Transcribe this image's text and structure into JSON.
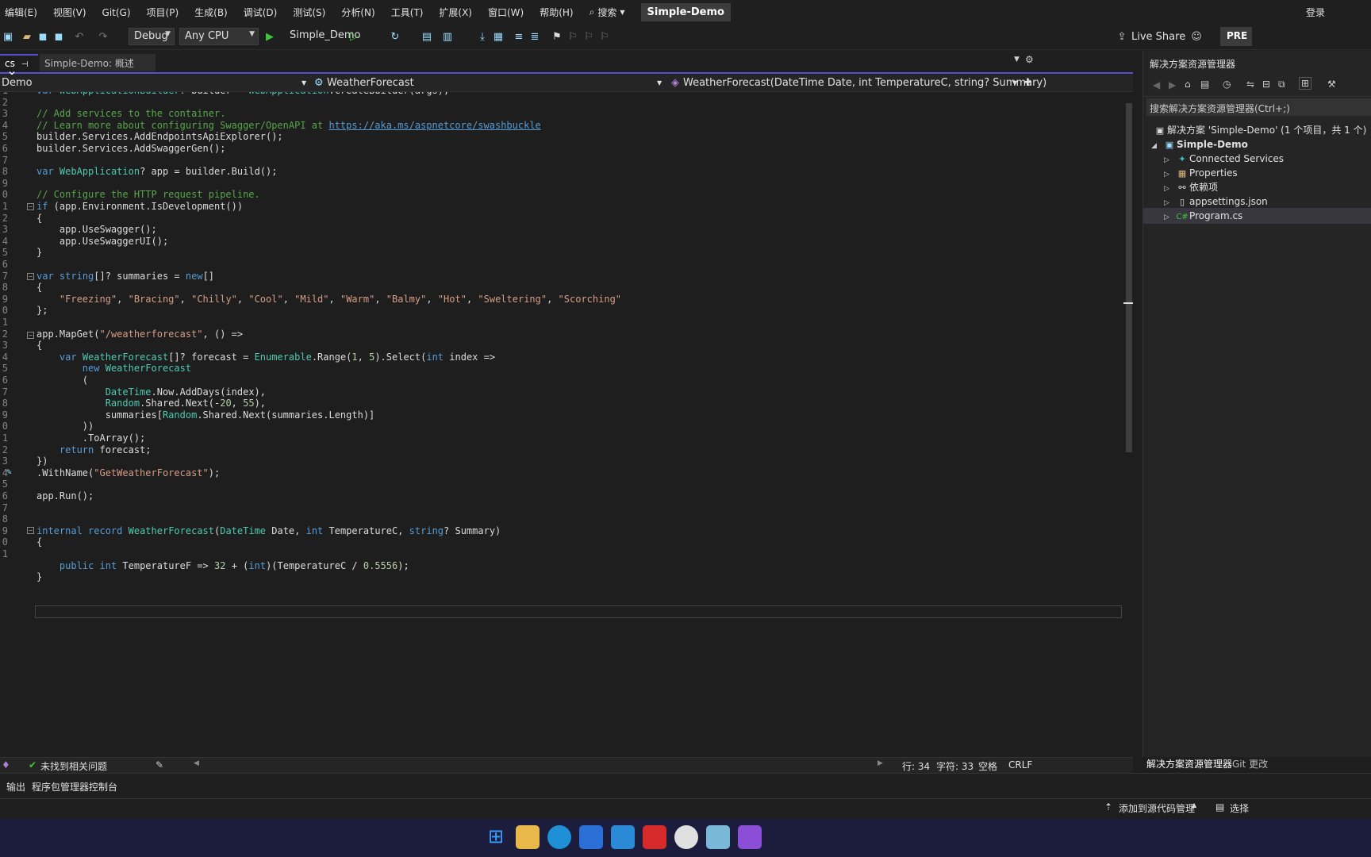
{
  "menu": [
    "编辑(E)",
    "视图(V)",
    "Git(G)",
    "项目(P)",
    "生成(B)",
    "调试(D)",
    "测试(S)",
    "分析(N)",
    "工具(T)",
    "扩展(X)",
    "窗口(W)",
    "帮助(H)"
  ],
  "search_label": "搜索",
  "title_badge": "Simple-Demo",
  "login": "登录",
  "toolbar": {
    "config": "Debug",
    "platform": "Any CPU",
    "run_target": "Simple_Demo",
    "live_share": "Live Share",
    "preview": "PRE"
  },
  "tabs": {
    "active": "cs",
    "other": "Simple-Demo: 概述"
  },
  "nav": {
    "project": "Demo",
    "type": "WeatherForecast",
    "member": "WeatherForecast(DateTime Date, int TemperatureC, string? Summary)"
  },
  "code": {
    "line_numbers": [
      "1",
      "2",
      "3",
      "4",
      "5",
      "6",
      "7",
      "8",
      "9",
      "0",
      "1",
      "2",
      "3",
      "4",
      "5",
      "6",
      "7",
      "8",
      "9",
      "0",
      "1",
      "2",
      "3",
      "4",
      "5",
      "6",
      "7",
      "8",
      "9",
      "0",
      "1",
      "2",
      "3",
      "4",
      "5",
      "6",
      "7",
      "8",
      "9",
      "0",
      "1"
    ],
    "lines": [
      "var WebApplicationBuilder? builder = WebApplication.CreateBuilder(args);",
      "",
      "// Add services to the container.",
      "// Learn more about configuring Swagger/OpenAPI at https://aka.ms/aspnetcore/swashbuckle",
      "builder.Services.AddEndpointsApiExplorer();",
      "builder.Services.AddSwaggerGen();",
      "",
      "var WebApplication? app = builder.Build();",
      "",
      "// Configure the HTTP request pipeline.",
      "if (app.Environment.IsDevelopment())",
      "{",
      "    app.UseSwagger();",
      "    app.UseSwaggerUI();",
      "}",
      "",
      "var string[]? summaries = new[]",
      "{",
      "    \"Freezing\", \"Bracing\", \"Chilly\", \"Cool\", \"Mild\", \"Warm\", \"Balmy\", \"Hot\", \"Sweltering\", \"Scorching\"",
      "};",
      "",
      "app.MapGet(\"/weatherforecast\", () =>",
      "{",
      "    var WeatherForecast[]? forecast = Enumerable.Range(1, 5).Select(int index =>",
      "        new WeatherForecast",
      "        (",
      "            DateTime.Now.AddDays(index),",
      "            Random.Shared.Next(-20, 55),",
      "            summaries[Random.Shared.Next(summaries.Length)]",
      "        ))",
      "        .ToArray();",
      "    return forecast;",
      "})",
      ".WithName(\"GetWeatherForecast\");",
      "",
      "app.Run();",
      "",
      "",
      "internal record WeatherForecast(DateTime Date, int TemperatureC, string? Summary)",
      "{",
      "",
      "    public int TemperatureF => 32 + (int)(TemperatureC / 0.5556);",
      "}"
    ]
  },
  "editor_status": {
    "issues": "未找到相关问题",
    "line": "行: 34",
    "char": "字符: 33",
    "spacing": "空格",
    "eol": "CRLF"
  },
  "bottom_tabs": [
    "输出",
    "程序包管理器控制台"
  ],
  "status": {
    "source_control": "添加到源代码管理",
    "select": "选择"
  },
  "solution": {
    "title": "解决方案资源管理器",
    "search": "搜索解决方案资源管理器(Ctrl+;)",
    "root": "解决方案 'Simple-Demo' (1 个项目，共 1 个)",
    "project": "Simple-Demo",
    "items": [
      "Connected Services",
      "Properties",
      "依赖项",
      "appsettings.json",
      "Program.cs"
    ],
    "tabs": [
      "解决方案资源管理器",
      "Git 更改"
    ]
  }
}
